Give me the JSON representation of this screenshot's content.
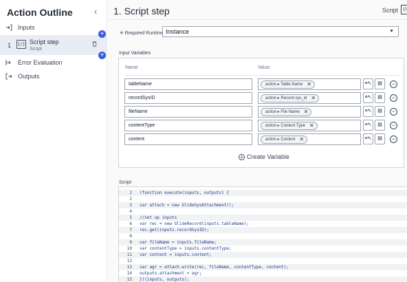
{
  "outline": {
    "title": "Action Outline",
    "collapse": "‹",
    "inputs_label": "Inputs",
    "step": {
      "number": "1",
      "name": "Script step",
      "type": "Script",
      "icon_text": "{/}"
    },
    "error_label": "Error Evaluation",
    "outputs_label": "Outputs"
  },
  "header": {
    "title": "1.  Script step",
    "right_label": "Script",
    "right_icon_text": "{/}"
  },
  "runtime": {
    "label": "✳ Required Runtime",
    "value": "Instance"
  },
  "input_variables": {
    "section_label": "Input Variables",
    "col_name": "Name",
    "col_value": "Value",
    "rows": [
      {
        "name": "tableName",
        "pill": "action ▸ Table Name"
      },
      {
        "name": "recordSysID",
        "pill": "action ▸ Record sys_id"
      },
      {
        "name": "fileName",
        "pill": "action ▸ File Name"
      },
      {
        "name": "contentType",
        "pill": "action ▸ Content Type"
      },
      {
        "name": "content",
        "pill": "action ▸ Content"
      }
    ],
    "create_label": "Create Variable"
  },
  "script": {
    "section_label": "Script",
    "lines": [
      "(function execute(inputs, outputs) {",
      "",
      "var attach = new GlideSysAttachment();",
      "",
      "//set up inputs",
      "var rec = new GlideRecord(inputs.tableName);",
      "rec.get(inputs.recordSysID);",
      "",
      "var fileName = inputs.fileName;",
      "var contentType = inputs.contentType;",
      "var content = inputs.content;",
      "",
      "var agr = attach.write(rec, fileName, contentType, content);",
      "outputs.attachment = agr;",
      "})(inputs, outputs);"
    ]
  },
  "colors": {
    "accent": "#3b5bdb",
    "panel_bg": "#e8ecf4"
  }
}
